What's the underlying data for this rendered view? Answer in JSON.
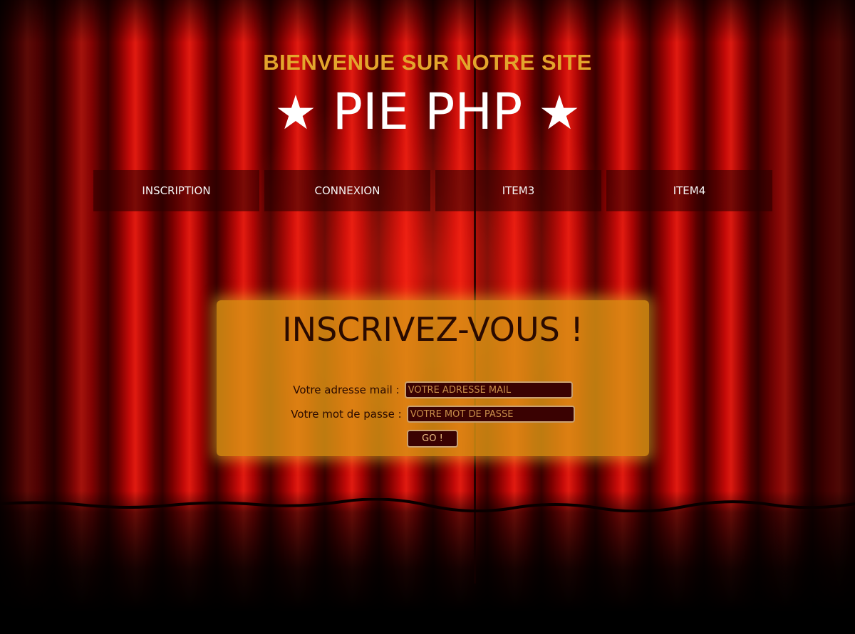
{
  "header": {
    "welcome": "BIENVENUE SUR NOTRE SITE",
    "site_title": "PIE PHP",
    "star_glyph": "★"
  },
  "nav": {
    "items": [
      {
        "label": "INSCRIPTION"
      },
      {
        "label": "CONNEXION"
      },
      {
        "label": "ITEM3"
      },
      {
        "label": "ITEM4"
      }
    ]
  },
  "form": {
    "title": "INSCRIVEZ-VOUS !",
    "email_label": "Votre adresse mail :",
    "email_placeholder": "VOTRE ADRESSE MAIL",
    "email_value": "",
    "password_label": "Votre mot de passe :",
    "password_placeholder": "VOTRE MOT DE PASSE",
    "password_value": "",
    "submit_label": "GO !"
  },
  "colors": {
    "welcome_gold": "#e3a52c",
    "form_card": "#dc9614",
    "input_bg": "#3a0202",
    "curtain_red": "#c40a08"
  }
}
